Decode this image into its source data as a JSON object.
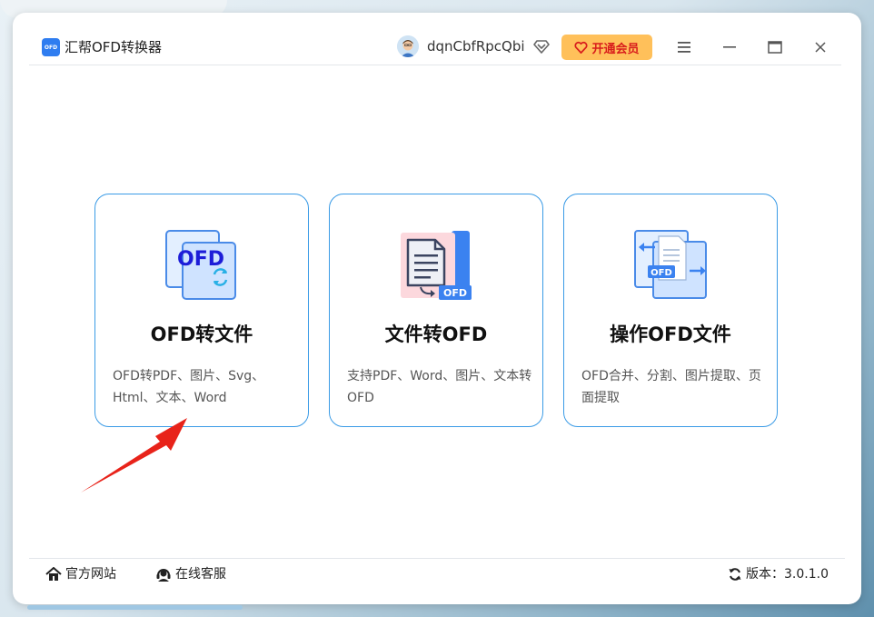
{
  "app": {
    "title": "汇帮OFD转换器",
    "logo_text": "OFD"
  },
  "header": {
    "username": "dqnCbfRpcQbi",
    "vip_label": "开通会员",
    "icons": [
      "avatar",
      "diamond-icon",
      "heart-icon",
      "menu-icon",
      "minimize-icon",
      "maximize-icon",
      "close-icon"
    ]
  },
  "cards": [
    {
      "title": "OFD转文件",
      "desc": "OFD转PDF、图片、Svg、Html、文本、Word",
      "icon_text": "OFD"
    },
    {
      "title": "文件转OFD",
      "desc": "支持PDF、Word、图片、文本转OFD",
      "icon_text": "OFD"
    },
    {
      "title": "操作OFD文件",
      "desc": "OFD合并、分割、图片提取、页面提取",
      "icon_text": "OFD"
    }
  ],
  "footer": {
    "website": "官方网站",
    "service": "在线客服",
    "version": "版本：3.0.1.0"
  },
  "colors": {
    "accent": "#3a9be6",
    "vip_bg": "#ffc05a",
    "vip_text": "#d81c1c",
    "arrow": "#e8231a"
  }
}
